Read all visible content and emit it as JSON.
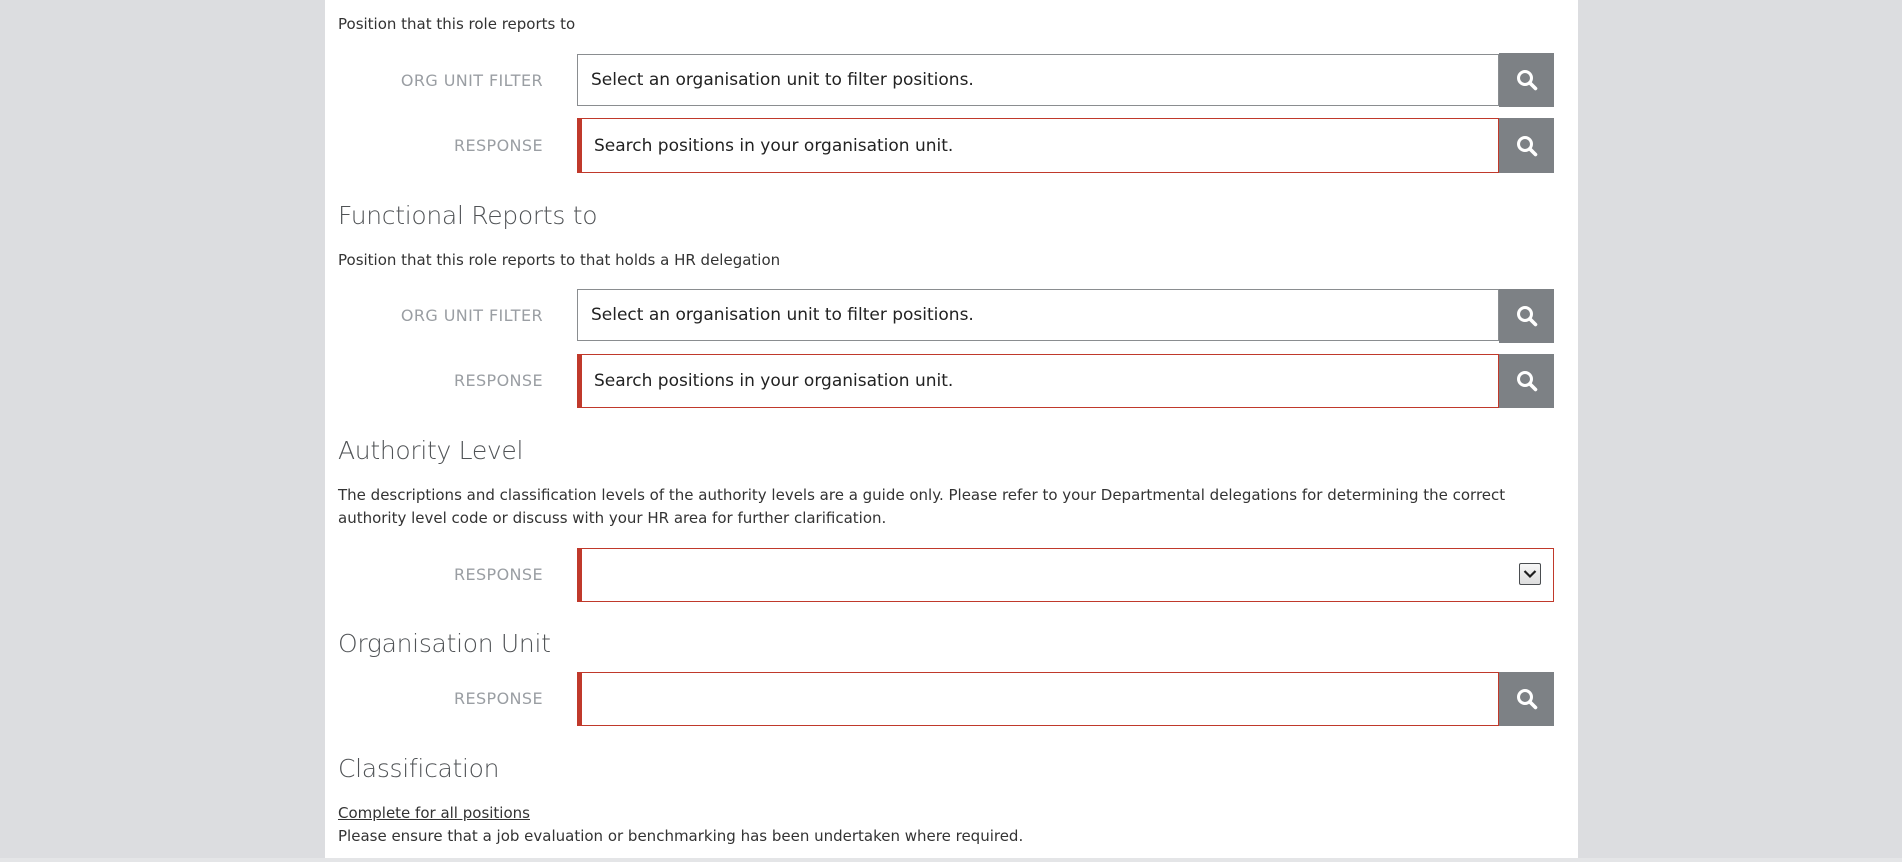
{
  "reports_to": {
    "description": "Position that this role reports to",
    "org_unit_filter": {
      "label": "ORG UNIT FILTER",
      "placeholder": "Select an organisation unit to filter positions."
    },
    "response": {
      "label": "RESPONSE",
      "placeholder": "Search positions in your organisation unit."
    }
  },
  "functional_reports_to": {
    "heading": "Functional Reports to",
    "description": "Position that this role reports to that holds a HR delegation",
    "org_unit_filter": {
      "label": "ORG UNIT FILTER",
      "placeholder": "Select an organisation unit to filter positions."
    },
    "response": {
      "label": "RESPONSE",
      "placeholder": "Search positions in your organisation unit."
    }
  },
  "authority_level": {
    "heading": "Authority Level",
    "description": "The descriptions and classification levels of the authority levels are a guide only. Please refer to your Departmental delegations for determining the correct authority level code or discuss with your HR area for further clarification.",
    "response": {
      "label": "RESPONSE",
      "selected_value": ""
    }
  },
  "organisation_unit": {
    "heading": "Organisation Unit",
    "response": {
      "label": "RESPONSE",
      "value": ""
    }
  },
  "classification": {
    "heading": "Classification",
    "link_text": "Complete for all positions",
    "note": "Please ensure that a job evaluation or benchmarking has been undertaken where required."
  },
  "icons": {
    "search": "search-icon",
    "dropdown": "chevron-down-icon"
  },
  "colors": {
    "required_border": "#c0392b",
    "search_button": "#7d8185",
    "page_background": "#dcdde0"
  }
}
